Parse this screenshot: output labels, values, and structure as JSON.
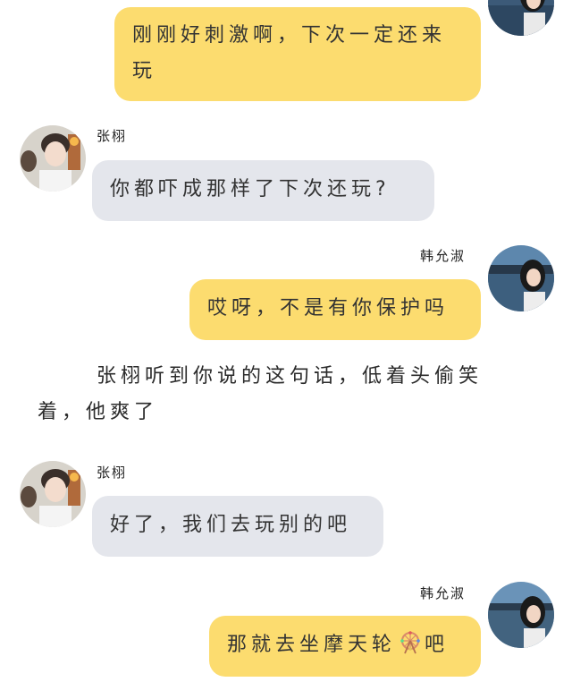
{
  "characters": {
    "male": {
      "name": "张栩"
    },
    "female": {
      "name": "韩允淑"
    }
  },
  "messages": [
    {
      "side": "right",
      "speaker": "",
      "text": "刚刚好刺激啊，下次一定还来玩"
    },
    {
      "side": "left",
      "speaker": "张栩",
      "text": "你都吓成那样了下次还玩?"
    },
    {
      "side": "right",
      "speaker": "韩允淑",
      "text": "哎呀，不是有你保护吗"
    },
    {
      "side": "narration",
      "text": "张栩听到你说的这句话，低着头偷笑着，他爽了"
    },
    {
      "side": "left",
      "speaker": "张栩",
      "text": "好了，我们去玩别的吧"
    },
    {
      "side": "right",
      "speaker": "韩允淑",
      "text_before": "那就去坐摩天轮",
      "emoji": "ferris-wheel-icon",
      "text_after": "吧"
    }
  ],
  "colors": {
    "right_bubble": "#fcdc6f",
    "left_bubble": "#e4e6ec",
    "background": "#ffffff"
  }
}
